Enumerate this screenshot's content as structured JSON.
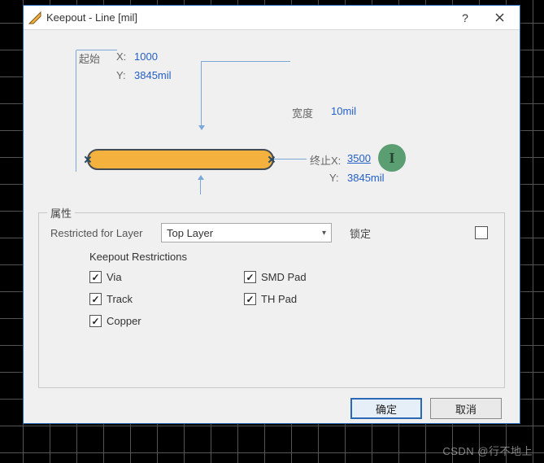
{
  "window": {
    "title": "Keepout - Line [mil]"
  },
  "start": {
    "label": "起始",
    "x_label": "X:",
    "x_value": "1000",
    "y_label": "Y:",
    "y_value": "3845mil"
  },
  "width": {
    "label": "宽度",
    "value": "10mil"
  },
  "end": {
    "label": "终止X:",
    "x_value": "3500",
    "y_label": "Y:",
    "y_value": "3845mil"
  },
  "properties": {
    "legend": "属性",
    "restricted_label": "Restricted for Layer",
    "layer_selected": "Top Layer",
    "lock_label": "锁定",
    "lock_checked": false,
    "restrictions_header": "Keepout Restrictions",
    "restrictions": [
      {
        "key": "via",
        "label": "Via",
        "checked": true
      },
      {
        "key": "smd",
        "label": "SMD Pad",
        "checked": true
      },
      {
        "key": "track",
        "label": "Track",
        "checked": true
      },
      {
        "key": "th",
        "label": "TH Pad",
        "checked": true
      },
      {
        "key": "copper",
        "label": "Copper",
        "checked": true
      }
    ]
  },
  "buttons": {
    "ok": "确定",
    "cancel": "取消"
  },
  "watermark": "CSDN @行不地上"
}
